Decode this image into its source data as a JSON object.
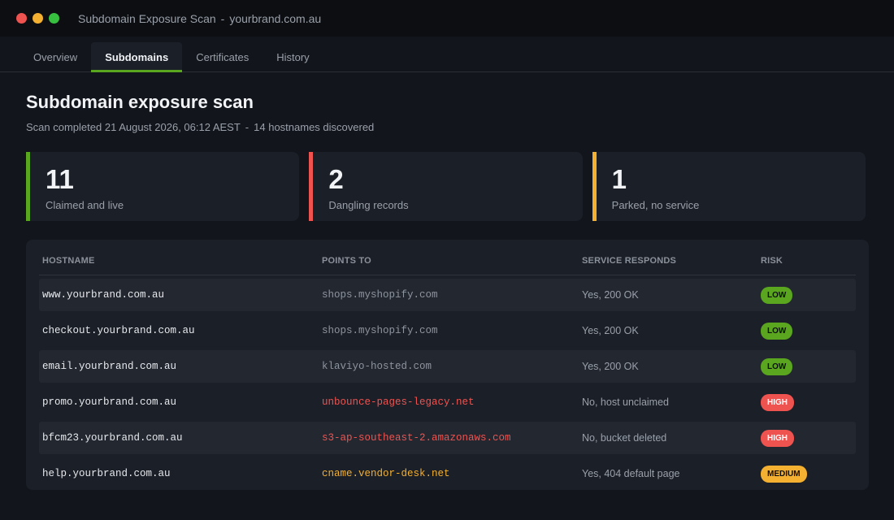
{
  "window": {
    "title": "Subdomain Exposure Scan",
    "separator": "-",
    "domain": "yourbrand.com.au"
  },
  "tabs": [
    {
      "label": "Overview"
    },
    {
      "label": "Subdomains"
    },
    {
      "label": "Certificates"
    },
    {
      "label": "History"
    }
  ],
  "header": {
    "title": "Subdomain exposure scan",
    "completed": "Scan completed 21 August 2026, 06:12 AEST",
    "separator": "-",
    "count": "14 hostnames discovered"
  },
  "cards": [
    {
      "number": "11",
      "label": "Claimed and live",
      "color": "#5aa61e"
    },
    {
      "number": "2",
      "label": "Dangling records",
      "color": "#ef5350"
    },
    {
      "number": "1",
      "label": "Parked, no service",
      "color": "#f4b030"
    }
  ],
  "table": {
    "headers": [
      "HOSTNAME",
      "POINTS TO",
      "SERVICE RESPONDS",
      "RISK"
    ],
    "rows": [
      {
        "host": "www.yourbrand.com.au",
        "target": "shops.myshopify.com",
        "service": "Yes, 200 OK",
        "risk": "LOW"
      },
      {
        "host": "checkout.yourbrand.com.au",
        "target": "shops.myshopify.com",
        "service": "Yes, 200 OK",
        "risk": "LOW"
      },
      {
        "host": "email.yourbrand.com.au",
        "target": "klaviyo-hosted.com",
        "service": "Yes, 200 OK",
        "risk": "LOW"
      },
      {
        "host": "promo.yourbrand.com.au",
        "target": "unbounce-pages-legacy.net",
        "service": "No, host unclaimed",
        "risk": "HIGH"
      },
      {
        "host": "bfcm23.yourbrand.com.au",
        "target": "s3-ap-southeast-2.amazonaws.com",
        "service": "No, bucket deleted",
        "risk": "HIGH"
      },
      {
        "host": "help.yourbrand.com.au",
        "target": "cname.vendor-desk.net",
        "service": "Yes, 404 default page",
        "risk": "MEDIUM"
      }
    ]
  },
  "colors": {
    "low": "#5aa61e",
    "high": "#ef5350",
    "medium": "#f4b030"
  }
}
